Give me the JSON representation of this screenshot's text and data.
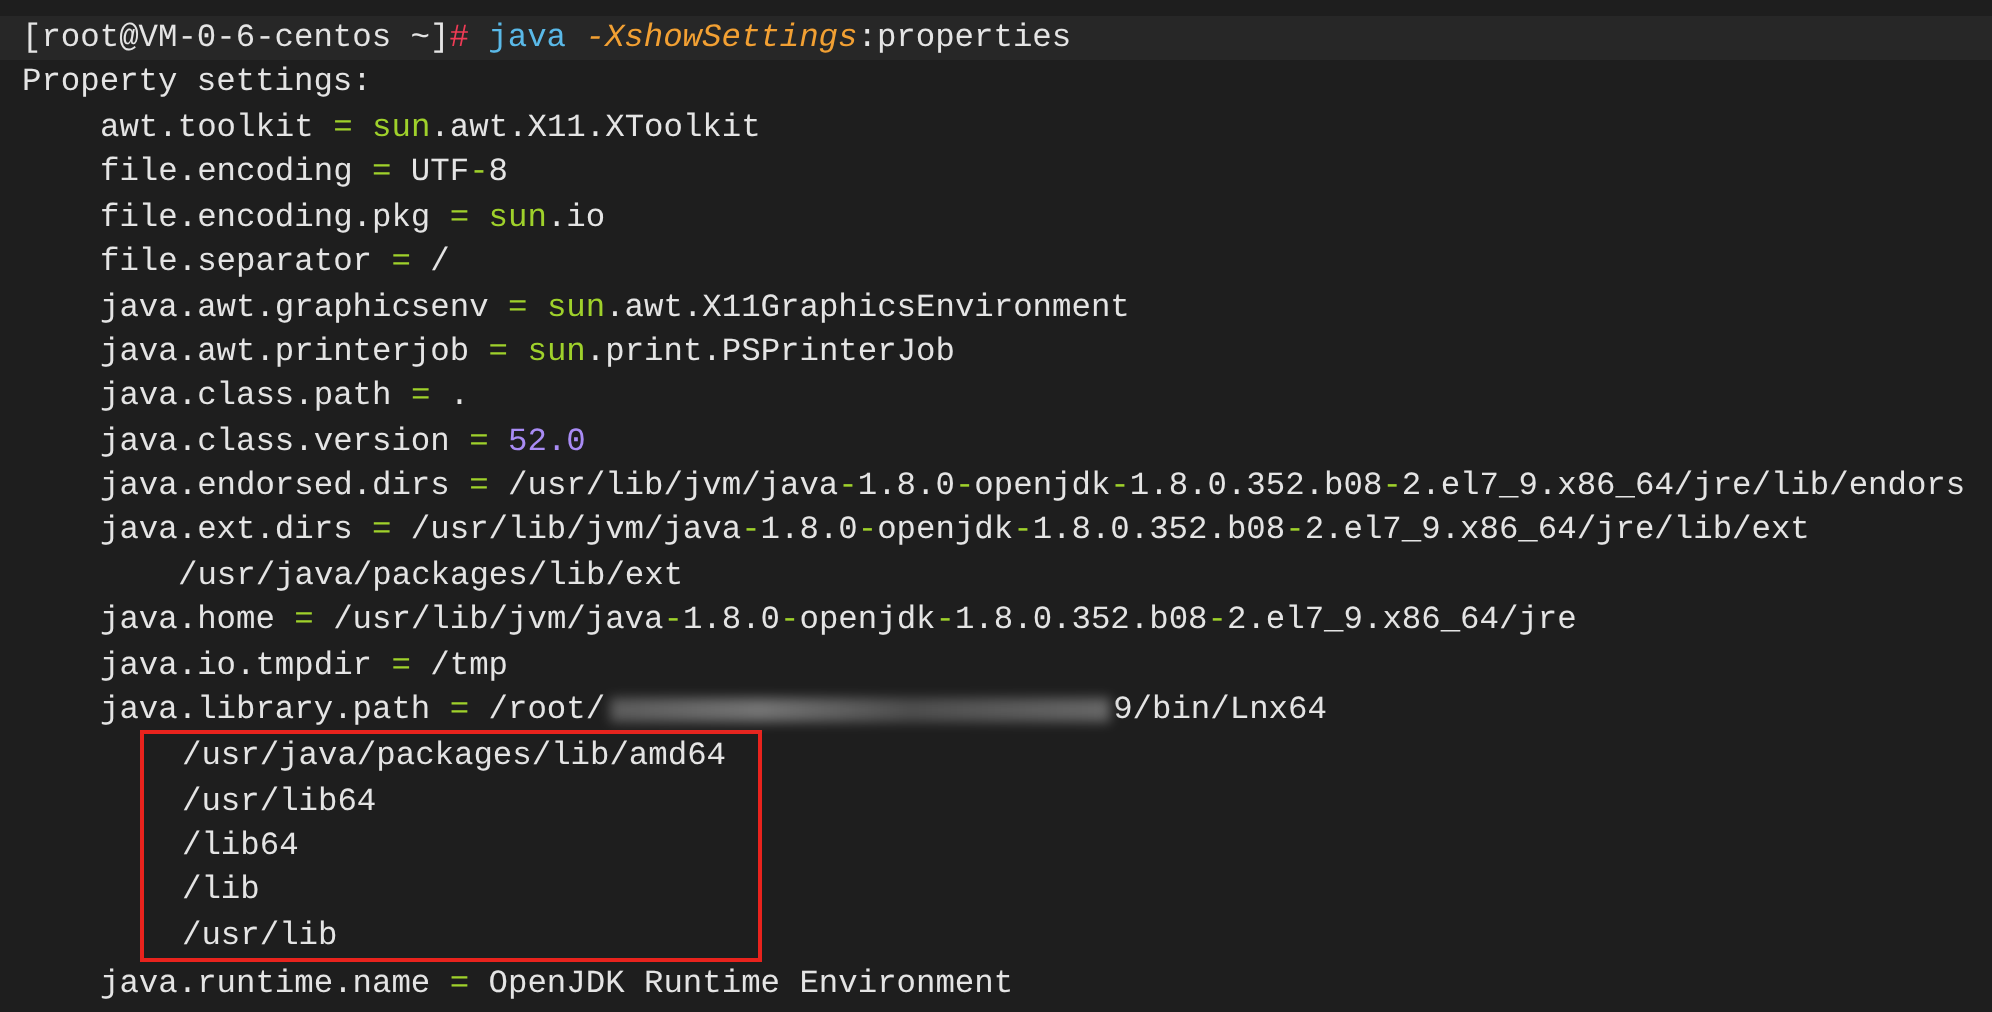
{
  "command": {
    "segments": [
      {
        "kind": "text",
        "text": "[root@VM-0-6-centos ~]"
      },
      {
        "kind": "prompt_sign",
        "text": "#"
      },
      {
        "kind": "command",
        "text": " java "
      },
      {
        "kind": "flag",
        "text": "-XshowSettings"
      },
      {
        "kind": "text",
        "text": ":properties"
      }
    ]
  },
  "output": {
    "heading": "Property settings:",
    "properties": [
      {
        "segments": [
          {
            "kind": "text",
            "text": "awt.toolkit "
          },
          {
            "kind": "operator",
            "text": "= "
          },
          {
            "kind": "keyword",
            "text": "sun"
          },
          {
            "kind": "text",
            "text": ".awt.X11.XToolkit"
          }
        ]
      },
      {
        "segments": [
          {
            "kind": "text",
            "text": "file.encoding "
          },
          {
            "kind": "operator",
            "text": "="
          },
          {
            "kind": "text",
            "text": " UTF"
          },
          {
            "kind": "operator",
            "text": "-"
          },
          {
            "kind": "text",
            "text": "8"
          }
        ]
      },
      {
        "segments": [
          {
            "kind": "text",
            "text": "file.encoding.pkg "
          },
          {
            "kind": "operator",
            "text": "= "
          },
          {
            "kind": "keyword",
            "text": "sun"
          },
          {
            "kind": "text",
            "text": ".io"
          }
        ]
      },
      {
        "segments": [
          {
            "kind": "text",
            "text": "file.separator "
          },
          {
            "kind": "operator",
            "text": "="
          },
          {
            "kind": "text",
            "text": " /"
          }
        ]
      },
      {
        "segments": [
          {
            "kind": "text",
            "text": "java.awt.graphicsenv "
          },
          {
            "kind": "operator",
            "text": "= "
          },
          {
            "kind": "keyword",
            "text": "sun"
          },
          {
            "kind": "text",
            "text": ".awt.X11GraphicsEnvironment"
          }
        ]
      },
      {
        "segments": [
          {
            "kind": "text",
            "text": "java.awt.printerjob "
          },
          {
            "kind": "operator",
            "text": "= "
          },
          {
            "kind": "keyword",
            "text": "sun"
          },
          {
            "kind": "text",
            "text": ".print.PSPrinterJob"
          }
        ]
      },
      {
        "segments": [
          {
            "kind": "text",
            "text": "java.class.path "
          },
          {
            "kind": "operator",
            "text": "="
          },
          {
            "kind": "text",
            "text": " ."
          }
        ]
      },
      {
        "segments": [
          {
            "kind": "text",
            "text": "java.class.version "
          },
          {
            "kind": "operator",
            "text": "= "
          },
          {
            "kind": "number",
            "text": "52.0"
          }
        ]
      },
      {
        "segments": [
          {
            "kind": "text",
            "text": "java.endorsed.dirs "
          },
          {
            "kind": "operator",
            "text": "="
          },
          {
            "kind": "text",
            "text": " /usr/lib/jvm/java"
          },
          {
            "kind": "operator",
            "text": "-"
          },
          {
            "kind": "text",
            "text": "1.8.0"
          },
          {
            "kind": "operator",
            "text": "-"
          },
          {
            "kind": "text",
            "text": "openjdk"
          },
          {
            "kind": "operator",
            "text": "-"
          },
          {
            "kind": "text",
            "text": "1.8.0.352.b08"
          },
          {
            "kind": "operator",
            "text": "-"
          },
          {
            "kind": "text",
            "text": "2.el7_9.x86_64/jre/lib/endors"
          }
        ]
      },
      {
        "segments": [
          {
            "kind": "text",
            "text": "java.ext.dirs "
          },
          {
            "kind": "operator",
            "text": "="
          },
          {
            "kind": "text",
            "text": " /usr/lib/jvm/java"
          },
          {
            "kind": "operator",
            "text": "-"
          },
          {
            "kind": "text",
            "text": "1.8.0"
          },
          {
            "kind": "operator",
            "text": "-"
          },
          {
            "kind": "text",
            "text": "openjdk"
          },
          {
            "kind": "operator",
            "text": "-"
          },
          {
            "kind": "text",
            "text": "1.8.0.352.b08"
          },
          {
            "kind": "operator",
            "text": "-"
          },
          {
            "kind": "text",
            "text": "2.el7_9.x86_64/jre/lib/ext"
          }
        ],
        "continuation": {
          "highlighted": false,
          "lines": [
            "/usr/java/packages/lib/ext"
          ]
        }
      },
      {
        "segments": [
          {
            "kind": "text",
            "text": "java.home "
          },
          {
            "kind": "operator",
            "text": "="
          },
          {
            "kind": "text",
            "text": " /usr/lib/jvm/java"
          },
          {
            "kind": "operator",
            "text": "-"
          },
          {
            "kind": "text",
            "text": "1.8.0"
          },
          {
            "kind": "operator",
            "text": "-"
          },
          {
            "kind": "text",
            "text": "openjdk"
          },
          {
            "kind": "operator",
            "text": "-"
          },
          {
            "kind": "text",
            "text": "1.8.0.352.b08"
          },
          {
            "kind": "operator",
            "text": "-"
          },
          {
            "kind": "text",
            "text": "2.el7_9.x86_64/jre"
          }
        ]
      },
      {
        "segments": [
          {
            "kind": "text",
            "text": "java.io.tmpdir "
          },
          {
            "kind": "operator",
            "text": "="
          },
          {
            "kind": "text",
            "text": " /tmp"
          }
        ]
      },
      {
        "segments": [
          {
            "kind": "text",
            "text": "java.library.path "
          },
          {
            "kind": "operator",
            "text": "="
          },
          {
            "kind": "text",
            "text": " /root/"
          },
          {
            "kind": "redacted"
          },
          {
            "kind": "text",
            "text": "9/bin/Lnx64"
          }
        ],
        "continuation": {
          "highlighted": true,
          "lines": [
            "/usr/java/packages/lib/amd64",
            "/usr/lib64",
            "/lib64",
            "/lib",
            "/usr/lib"
          ]
        }
      },
      {
        "segments": [
          {
            "kind": "text",
            "text": "java.runtime.name "
          },
          {
            "kind": "operator",
            "text": "="
          },
          {
            "kind": "text",
            "text": " OpenJDK Runtime Environment"
          }
        ]
      }
    ]
  }
}
